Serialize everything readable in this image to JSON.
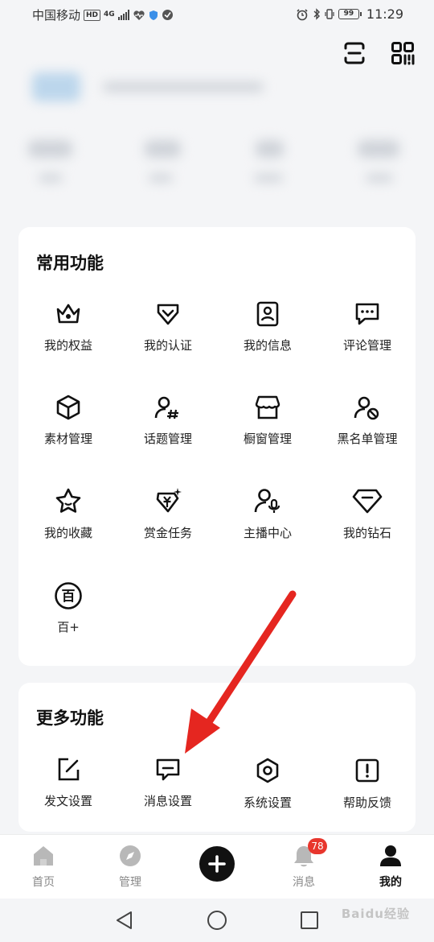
{
  "status_bar": {
    "carrier": "中国移动",
    "hd": "HD",
    "network": "4G",
    "battery": "99",
    "time": "11:29"
  },
  "header": {
    "scan_icon": "scan-icon",
    "qr_icon": "qr-code-icon"
  },
  "common_functions": {
    "title": "常用功能",
    "items": [
      {
        "label": "我的权益",
        "icon": "crown-icon"
      },
      {
        "label": "我的认证",
        "icon": "verified-badge-icon"
      },
      {
        "label": "我的信息",
        "icon": "profile-card-icon"
      },
      {
        "label": "评论管理",
        "icon": "comment-icon"
      },
      {
        "label": "素材管理",
        "icon": "cube-icon"
      },
      {
        "label": "话题管理",
        "icon": "topic-icon"
      },
      {
        "label": "橱窗管理",
        "icon": "shop-window-icon"
      },
      {
        "label": "黑名单管理",
        "icon": "blocked-user-icon"
      },
      {
        "label": "我的收藏",
        "icon": "star-icon"
      },
      {
        "label": "赏金任务",
        "icon": "bounty-icon"
      },
      {
        "label": "主播中心",
        "icon": "streamer-mic-icon"
      },
      {
        "label": "我的钻石",
        "icon": "diamond-icon"
      },
      {
        "label": "百+",
        "icon": "bai-plus-icon",
        "glyph": "百"
      }
    ]
  },
  "more_functions": {
    "title": "更多功能",
    "items": [
      {
        "label": "发文设置",
        "icon": "edit-post-icon"
      },
      {
        "label": "消息设置",
        "icon": "message-settings-icon"
      },
      {
        "label": "系统设置",
        "icon": "system-settings-icon"
      },
      {
        "label": "帮助反馈",
        "icon": "help-feedback-icon"
      }
    ]
  },
  "tab_bar": {
    "tabs": [
      {
        "label": "首页",
        "icon": "home-icon"
      },
      {
        "label": "管理",
        "icon": "compass-icon"
      },
      {
        "label": "",
        "icon": "plus-icon"
      },
      {
        "label": "消息",
        "icon": "bell-icon",
        "badge": "78"
      },
      {
        "label": "我的",
        "icon": "user-icon",
        "active": true
      }
    ]
  },
  "nav_bar": {
    "back_icon": "back-triangle-icon",
    "home_icon": "home-circle-icon",
    "recent_icon": "recent-apps-icon"
  },
  "watermark": "Baidu经验",
  "colors": {
    "background": "#f4f5f7",
    "card": "#ffffff",
    "badge": "#e8362d",
    "arrow": "#e52620",
    "text": "#222222"
  }
}
